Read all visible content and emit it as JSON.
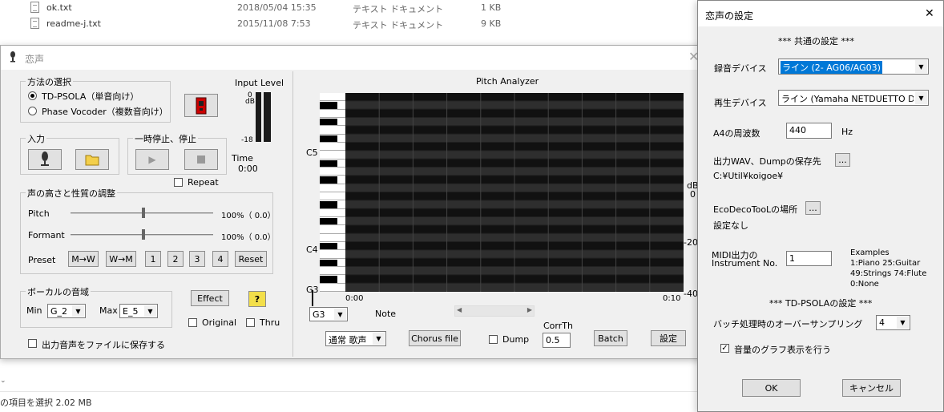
{
  "explorer": {
    "files": [
      {
        "name": "ok.txt",
        "date": "2018/05/04 15:35",
        "type": "テキスト ドキュメント",
        "size": "1 KB"
      },
      {
        "name": "readme-j.txt",
        "date": "2015/11/08 7:53",
        "type": "テキスト ドキュメント",
        "size": "9 KB"
      }
    ],
    "status": "の項目を選択  2.02 MB"
  },
  "main": {
    "title": "恋声",
    "method": {
      "group": "方法の選択",
      "psola": "TD-PSOLA（単音向け）",
      "vocoder": "Phase Vocoder（複数音向け）",
      "selected": "psola"
    },
    "input_level": {
      "label": "Input Level",
      "top": "0",
      "unit": "dB",
      "bottom": "-18"
    },
    "input_group": "入力",
    "pause_group": "一時停止、停止",
    "time_label": "Time",
    "time_value": "0:00",
    "repeat": "Repeat",
    "adjust": {
      "group": "声の高さと性質の調整",
      "pitch_label": "Pitch",
      "pitch_value": "100%（ 0.0）",
      "pitch_position": 0.5,
      "formant_label": "Formant",
      "formant_value": "100%（ 0.0）",
      "formant_position": 0.5,
      "preset_label": "Preset",
      "presets": [
        "M→W",
        "W→M",
        "1",
        "2",
        "3",
        "4",
        "Reset"
      ]
    },
    "vocal_range": {
      "group": "ボーカルの音域",
      "min_label": "Min",
      "min": "G_2",
      "max_label": "Max",
      "max": "E_5"
    },
    "effect": "Effect",
    "help": "?",
    "original": "Original",
    "thru": "Thru",
    "save_output": "出力音声をファイルに保存する",
    "analyzer": {
      "title": "Pitch Analyzer",
      "notes": [
        "C5",
        "C4",
        "G3"
      ],
      "db_unit": "dB",
      "db_ticks": [
        "0",
        "-20",
        "-40"
      ],
      "time_start": "0:00",
      "time_end": "0:10",
      "note_select": "G3",
      "note_label": "Note"
    },
    "mode": "通常 歌声",
    "chorus": "Chorus file",
    "dump": "Dump",
    "corrth_label": "CorrTh",
    "corrth_value": "0.5",
    "batch": "Batch",
    "settings_btn": "設定"
  },
  "settings": {
    "title": "恋声の設定",
    "common_header": "*** 共通の設定 ***",
    "rec_label": "録音デバイス",
    "rec_device": "ライン (2- AG06/AG03)",
    "play_label": "再生デバイス",
    "play_device": "ライン (Yamaha NETDUETTO Driver",
    "a4_label": "A4の周波数",
    "a4_value": "440",
    "a4_unit": "Hz",
    "save_label": "出力WAV、Dumpの保存先",
    "save_path": "C:¥Util¥koigoe¥",
    "eco_label": "EcoDecoTooLの場所",
    "eco_value": "設定なし",
    "dots": "...",
    "midi_label1": "MIDI出力の",
    "midi_label2": "Instrument No.",
    "midi_value": "1",
    "examples": [
      "Examples",
      "1:Piano  25:Guitar",
      "49:Strings  74:Flute",
      "0:None"
    ],
    "psola_header": "*** TD-PSOLAの設定 ***",
    "oversample_label": "バッチ処理時のオーバーサンプリング",
    "oversample_value": "4",
    "graph_label": "音量のグラフ表示を行う",
    "ok": "OK",
    "cancel": "キャンセル"
  }
}
